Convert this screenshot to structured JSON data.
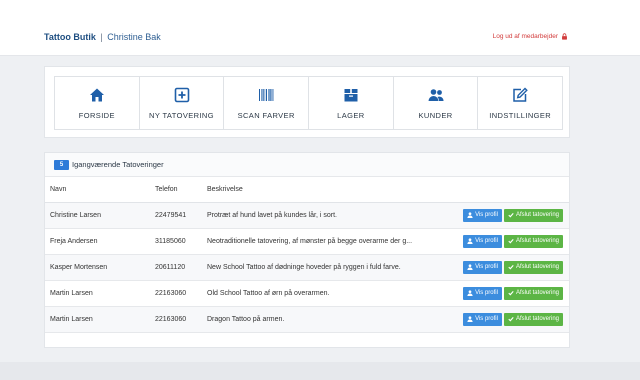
{
  "header": {
    "brand": "Tattoo Butik",
    "separator": "|",
    "user": "Christine Bak",
    "logout_label": "Log ud af medarbejder"
  },
  "nav": {
    "items": [
      {
        "label": "FORSIDE",
        "icon": "home-icon"
      },
      {
        "label": "NY TATOVERING",
        "icon": "plus-square-icon"
      },
      {
        "label": "SCAN FARVER",
        "icon": "barcode-icon"
      },
      {
        "label": "LAGER",
        "icon": "box-icon"
      },
      {
        "label": "KUNDER",
        "icon": "users-icon"
      },
      {
        "label": "INDSTILLINGER",
        "icon": "edit-icon"
      }
    ]
  },
  "active_list": {
    "count": "5",
    "title": "Igangværende Tatoveringer",
    "columns": [
      "Navn",
      "Telefon",
      "Beskrivelse"
    ],
    "view_label": "Vis profil",
    "finish_label": "Afslut tatovering",
    "rows": [
      {
        "name": "Christine Larsen",
        "phone": "22479541",
        "desc": "Protræt af hund lavet på kundes lår, i sort."
      },
      {
        "name": "Freja Andersen",
        "phone": "31185060",
        "desc": "Neotraditionelle tatovering, af mønster på begge overarme der g..."
      },
      {
        "name": "Kasper Mortensen",
        "phone": "20611120",
        "desc": "New School Tattoo af dødninge hoveder på ryggen i fuld farve."
      },
      {
        "name": "Martin Larsen",
        "phone": "22163060",
        "desc": "Old School Tattoo af ørn på overarmen."
      },
      {
        "name": "Martin Larsen",
        "phone": "22163060",
        "desc": "Dragon Tattoo på armen."
      }
    ]
  },
  "colors": {
    "brand": "#1f4f82",
    "logout": "#d23b3b",
    "primary": "#3c8dde",
    "success": "#5cb545"
  }
}
